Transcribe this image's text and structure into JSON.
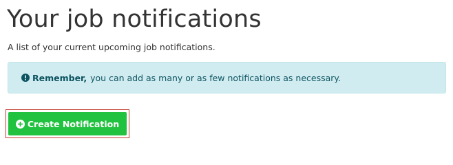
{
  "page": {
    "title": "Your job notifications",
    "subtitle": "A list of your current upcoming job notifications."
  },
  "alert": {
    "icon": "exclamation-circle-icon",
    "strong_text": "Remember,",
    "message": "you can add as many or as few notifications as necessary.",
    "background_color": "#d1ecf1",
    "text_color": "#0c5460"
  },
  "actions": {
    "create_button_icon": "plus-circle-icon",
    "create_button_label": "Create Notification",
    "create_button_color": "#21c23f",
    "highlight_border_color": "#c0392b"
  }
}
